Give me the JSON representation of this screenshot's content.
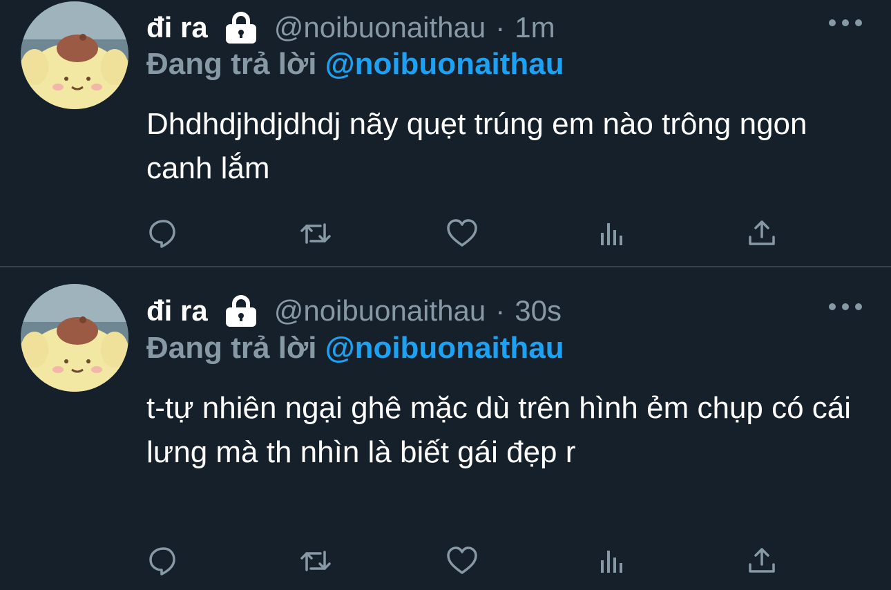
{
  "tweets": [
    {
      "author_name": "đi ra",
      "handle": "@noibuonaithau",
      "separator": "·",
      "time": "1m",
      "reply_prefix": "Đang trả lời",
      "reply_target": "@noibuonaithau",
      "text": "Dhdhdjhdjdhdj nãy quẹt trúng em nào trông ngon canh lắm",
      "icons": [
        "lock-icon",
        "more-icon",
        "reply-icon",
        "retweet-icon",
        "like-icon",
        "stats-icon",
        "share-icon"
      ]
    },
    {
      "author_name": "đi ra",
      "handle": "@noibuonaithau",
      "separator": "·",
      "time": "30s",
      "reply_prefix": "Đang trả lời",
      "reply_target": "@noibuonaithau",
      "text": "t-tự nhiên ngại ghê mặc dù trên hình ẻm chụp có cái lưng mà th nhìn là biết gái đẹp r",
      "icons": [
        "lock-icon",
        "more-icon",
        "reply-icon",
        "retweet-icon",
        "like-icon",
        "stats-icon",
        "share-icon"
      ]
    }
  ],
  "colors": {
    "background": "#15202b",
    "muted": "#8899a6",
    "accent": "#1da1f2",
    "divider": "#38444d"
  }
}
